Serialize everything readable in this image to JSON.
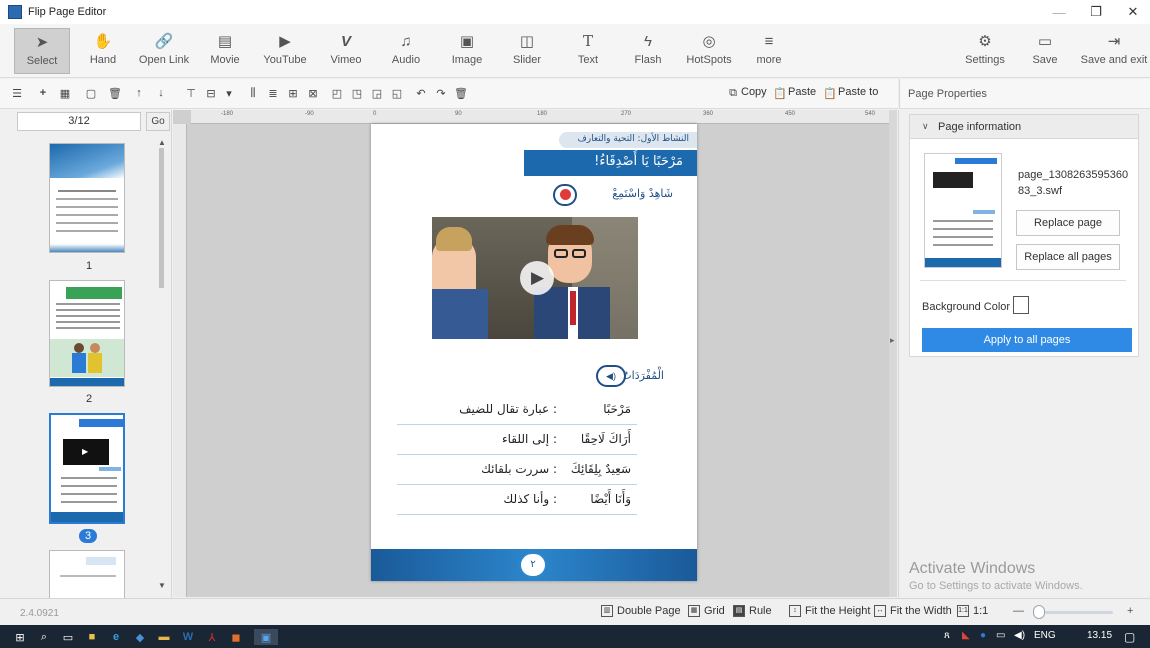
{
  "window": {
    "title": "Flip Page Editor",
    "minimize_icon": "—",
    "restore_icon": "❐",
    "close_icon": "✕"
  },
  "toolbar": {
    "tools": [
      {
        "label": "Select",
        "icon": "cursor-icon",
        "glyph": "➤",
        "active": true
      },
      {
        "label": "Hand",
        "icon": "hand-icon",
        "glyph": "✋"
      },
      {
        "label": "Open Link",
        "icon": "link-icon",
        "glyph": "🔗"
      },
      {
        "label": "Movie",
        "icon": "film-icon",
        "glyph": "▤"
      },
      {
        "label": "YouTube",
        "icon": "youtube-icon",
        "glyph": "▶"
      },
      {
        "label": "Vimeo",
        "icon": "vimeo-icon",
        "glyph": "V"
      },
      {
        "label": "Audio",
        "icon": "music-icon",
        "glyph": "♫"
      },
      {
        "label": "Image",
        "icon": "image-icon",
        "glyph": "▣"
      },
      {
        "label": "Slider",
        "icon": "slider-icon",
        "glyph": "◫"
      },
      {
        "label": "Text",
        "icon": "text-icon",
        "glyph": "T"
      },
      {
        "label": "Flash",
        "icon": "flash-icon",
        "glyph": "ϟ"
      },
      {
        "label": "HotSpots",
        "icon": "hotspot-icon",
        "glyph": "◎"
      },
      {
        "label": "more",
        "icon": "more-icon",
        "glyph": "≡"
      }
    ],
    "right": [
      {
        "label": "Settings",
        "icon": "gear-icon",
        "glyph": "⚙"
      },
      {
        "label": "Save",
        "icon": "save-icon",
        "glyph": "▭"
      },
      {
        "label": "Save and exit",
        "icon": "exit-icon",
        "glyph": "⇥"
      }
    ]
  },
  "subtoolbar": {
    "copy": "Copy",
    "paste": "Paste",
    "paste_to": "Paste to"
  },
  "left_panel": {
    "page_input": "3/12",
    "go_label": "Go",
    "thumbnails": [
      {
        "num": "1"
      },
      {
        "num": "2"
      },
      {
        "num": "3",
        "selected": true
      }
    ]
  },
  "ruler": {
    "h_labels": [
      "-180",
      "-90",
      "0",
      "90",
      "180",
      "270",
      "360",
      "450",
      "540"
    ]
  },
  "page": {
    "section_title": "النشاط الأول: التحية والتعارف",
    "banner": "مَرْحَبًا يَا أَصْدِقَاءُ!",
    "watch_listen": "شَاهِدْ وَاسْتَمِعْ",
    "vocab_title": "الْمُفْرَدَاتُ",
    "vocab": [
      {
        "word": "مَرْحَبًا",
        "meaning": ": عبارة تقال للضيف"
      },
      {
        "word": "أَرَاكَ لَاحِقًا",
        "meaning": ": إلى اللقاء"
      },
      {
        "word": "سَعِيدٌ بِلِقَائِكَ",
        "meaning": ": سررت بلقائك"
      },
      {
        "word": "وَأَنَا أَيْضًا",
        "meaning": ": وأنا كذلك"
      }
    ],
    "page_number": "٢"
  },
  "properties": {
    "header": "Page Properties",
    "section": "Page information",
    "file_name": "page_130826359536083_3.swf",
    "replace_page": "Replace page",
    "replace_all": "Replace all pages",
    "bg_color_label": "Background Color",
    "apply_all": "Apply to all pages"
  },
  "watermark": {
    "line1": "Activate Windows",
    "line2": "Go to Settings to activate Windows."
  },
  "statusbar": {
    "version": "2.4.0921",
    "double_page": "Double Page",
    "grid": "Grid",
    "rule": "Rule",
    "fit_height": "Fit the Height",
    "fit_width": "Fit the Width",
    "one_to_one": "1:1",
    "zoom_minus": "—",
    "zoom_plus": "+"
  },
  "taskbar": {
    "lang": "ENG",
    "time": "13.15"
  },
  "colors": {
    "accent": "#2f8ae5",
    "banner": "#1d69ad",
    "select_border": "#2b7bd6"
  }
}
